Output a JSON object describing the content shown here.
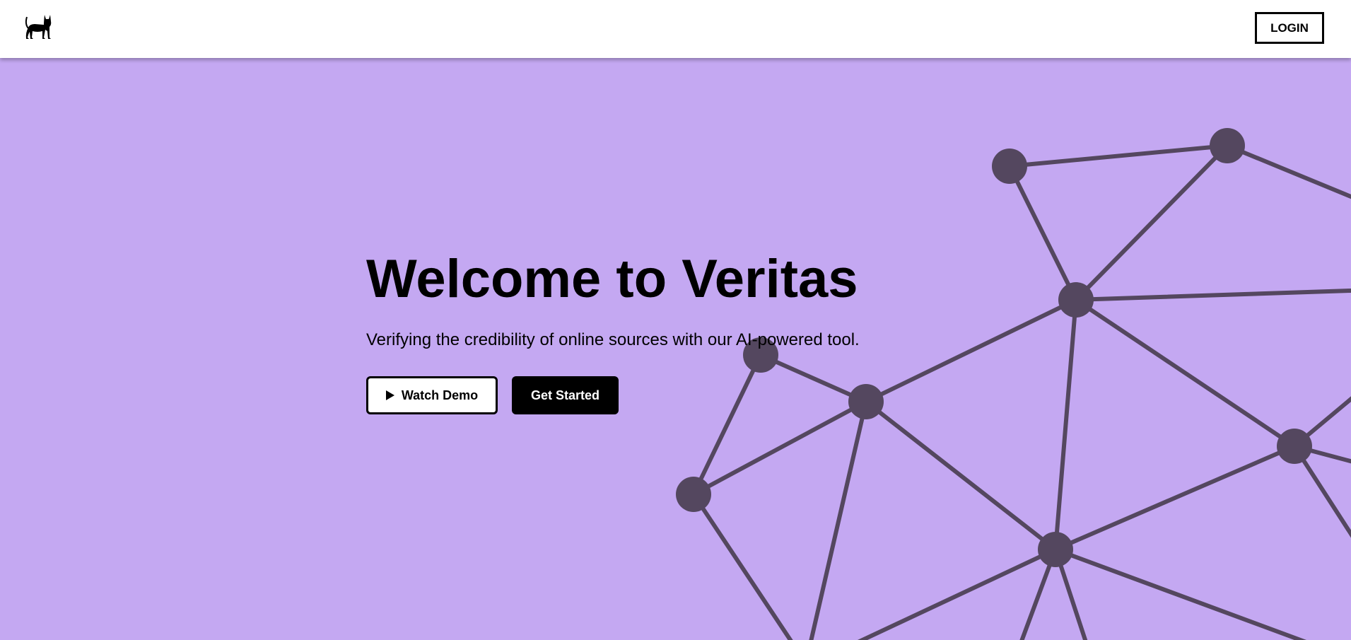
{
  "header": {
    "logo_icon": "cat-icon",
    "login_label": "LOGIN"
  },
  "hero": {
    "background_color": "#c4a8f2",
    "network_color": "#54475f",
    "title": "Welcome to Veritas",
    "subtitle": "Verifying the credibility of online sources with our AI-powered tool.",
    "watch_demo_icon": "play-icon",
    "watch_demo_label": "Watch Demo",
    "get_started_label": "Get Started"
  }
}
